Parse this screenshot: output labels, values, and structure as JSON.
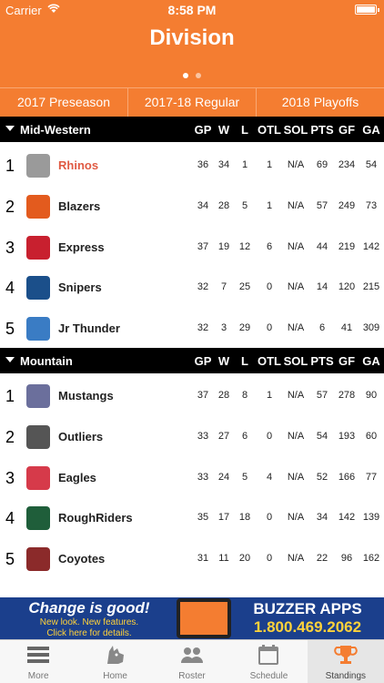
{
  "status_bar": {
    "carrier": "Carrier",
    "time": "8:58 PM"
  },
  "header": {
    "title": "Division"
  },
  "segments": [
    "2017 Preseason",
    "2017-18 Regular",
    "2018 Playoffs"
  ],
  "columns": [
    "GP",
    "W",
    "L",
    "OTL",
    "SOL",
    "PTS",
    "GF",
    "GA"
  ],
  "divisions": [
    {
      "name": "Mid-Western",
      "teams": [
        {
          "rank": "1",
          "name": "Rhinos",
          "highlight": true,
          "logo": "rhino-icon",
          "color": "#9a9a9a",
          "stats": [
            "36",
            "34",
            "1",
            "1",
            "N/A",
            "69",
            "234",
            "54"
          ]
        },
        {
          "rank": "2",
          "name": "Blazers",
          "highlight": false,
          "logo": "blazers-icon",
          "color": "#e35b1e",
          "stats": [
            "34",
            "28",
            "5",
            "1",
            "N/A",
            "57",
            "249",
            "73"
          ]
        },
        {
          "rank": "3",
          "name": "Express",
          "highlight": false,
          "logo": "express-icon",
          "color": "#c8202f",
          "stats": [
            "37",
            "19",
            "12",
            "6",
            "N/A",
            "44",
            "219",
            "142"
          ]
        },
        {
          "rank": "4",
          "name": "Snipers",
          "highlight": false,
          "logo": "snipers-icon",
          "color": "#1b4f8a",
          "stats": [
            "32",
            "7",
            "25",
            "0",
            "N/A",
            "14",
            "120",
            "215"
          ]
        },
        {
          "rank": "5",
          "name": "Jr Thunder",
          "highlight": false,
          "logo": "thunder-icon",
          "color": "#3a7cc4",
          "stats": [
            "32",
            "3",
            "29",
            "0",
            "N/A",
            "6",
            "41",
            "309"
          ]
        }
      ]
    },
    {
      "name": "Mountain",
      "teams": [
        {
          "rank": "1",
          "name": "Mustangs",
          "highlight": false,
          "logo": "mustang-icon",
          "color": "#6b6f9c",
          "stats": [
            "37",
            "28",
            "8",
            "1",
            "N/A",
            "57",
            "278",
            "90"
          ]
        },
        {
          "rank": "2",
          "name": "Outliers",
          "highlight": false,
          "logo": "outliers-icon",
          "color": "#555555",
          "stats": [
            "33",
            "27",
            "6",
            "0",
            "N/A",
            "54",
            "193",
            "60"
          ]
        },
        {
          "rank": "3",
          "name": "Eagles",
          "highlight": false,
          "logo": "eagles-icon",
          "color": "#d63a4a",
          "stats": [
            "33",
            "24",
            "5",
            "4",
            "N/A",
            "52",
            "166",
            "77"
          ]
        },
        {
          "rank": "4",
          "name": "RoughRiders",
          "highlight": false,
          "logo": "roughriders-icon",
          "color": "#1f5e3a",
          "stats": [
            "35",
            "17",
            "18",
            "0",
            "N/A",
            "34",
            "142",
            "139"
          ]
        },
        {
          "rank": "5",
          "name": "Coyotes",
          "highlight": false,
          "logo": "coyotes-icon",
          "color": "#8b2a2a",
          "stats": [
            "31",
            "11",
            "20",
            "0",
            "N/A",
            "22",
            "96",
            "162"
          ]
        }
      ]
    }
  ],
  "ad": {
    "headline": "Change is good!",
    "sub1": "New look. New features.",
    "sub2": "Click here for details.",
    "brand": "BUZZER APPS",
    "phone": "1.800.469.2062"
  },
  "tabs": [
    {
      "label": "More",
      "icon": "menu-icon",
      "active": false
    },
    {
      "label": "Home",
      "icon": "rhino-icon",
      "active": false
    },
    {
      "label": "Roster",
      "icon": "people-icon",
      "active": false
    },
    {
      "label": "Schedule",
      "icon": "calendar-icon",
      "active": false
    },
    {
      "label": "Standings",
      "icon": "trophy-icon",
      "active": true
    }
  ],
  "colors": {
    "accent": "#f47d31",
    "highlight": "#e05a43",
    "ad_bg": "#1b3f8c",
    "ad_yellow": "#ffd23a"
  }
}
